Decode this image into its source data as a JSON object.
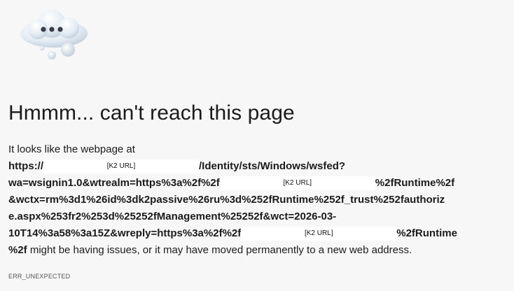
{
  "error_page": {
    "heading": "Hmmm... can't reach this page",
    "intro": "It looks like the webpage at",
    "url_line1_prefix": "https://",
    "redacted_label": "[K2 URL]",
    "url_line1_suffix": "/Identity/sts/Windows/wsfed?",
    "url_line2_prefix": "wa=wsignin1.0&wtrealm=https%3a%2f%2f",
    "url_line2_suffix": "%2fRuntime%2f",
    "url_line3": "&wctx=rm%3d1%26id%3dk2passive%26ru%3d%252fRuntime%252f_trust%252fauthoriz",
    "url_line4": "e.aspx%253fr2%253d%25252fManagement%25252f&wct=2026-03-",
    "url_line5_prefix": "10T14%3a58%3a15Z&wreply=https%3a%2f%2f",
    "url_line5_suffix": "%2fRuntime",
    "url_line6_bold": "%2f",
    "url_line6_rest": " might be having issues, or it may have moved permanently to a new web address.",
    "error_code": "ERR_UNEXPECTED"
  },
  "icons": {
    "illustration": "cloud-with-dots-icon"
  },
  "colors": {
    "background": "#f7f7f7",
    "text": "#1b1b1b",
    "cloud_light": "#eef3f8",
    "cloud_shadow": "#b9c8d8",
    "dots": "#3c3c46"
  }
}
